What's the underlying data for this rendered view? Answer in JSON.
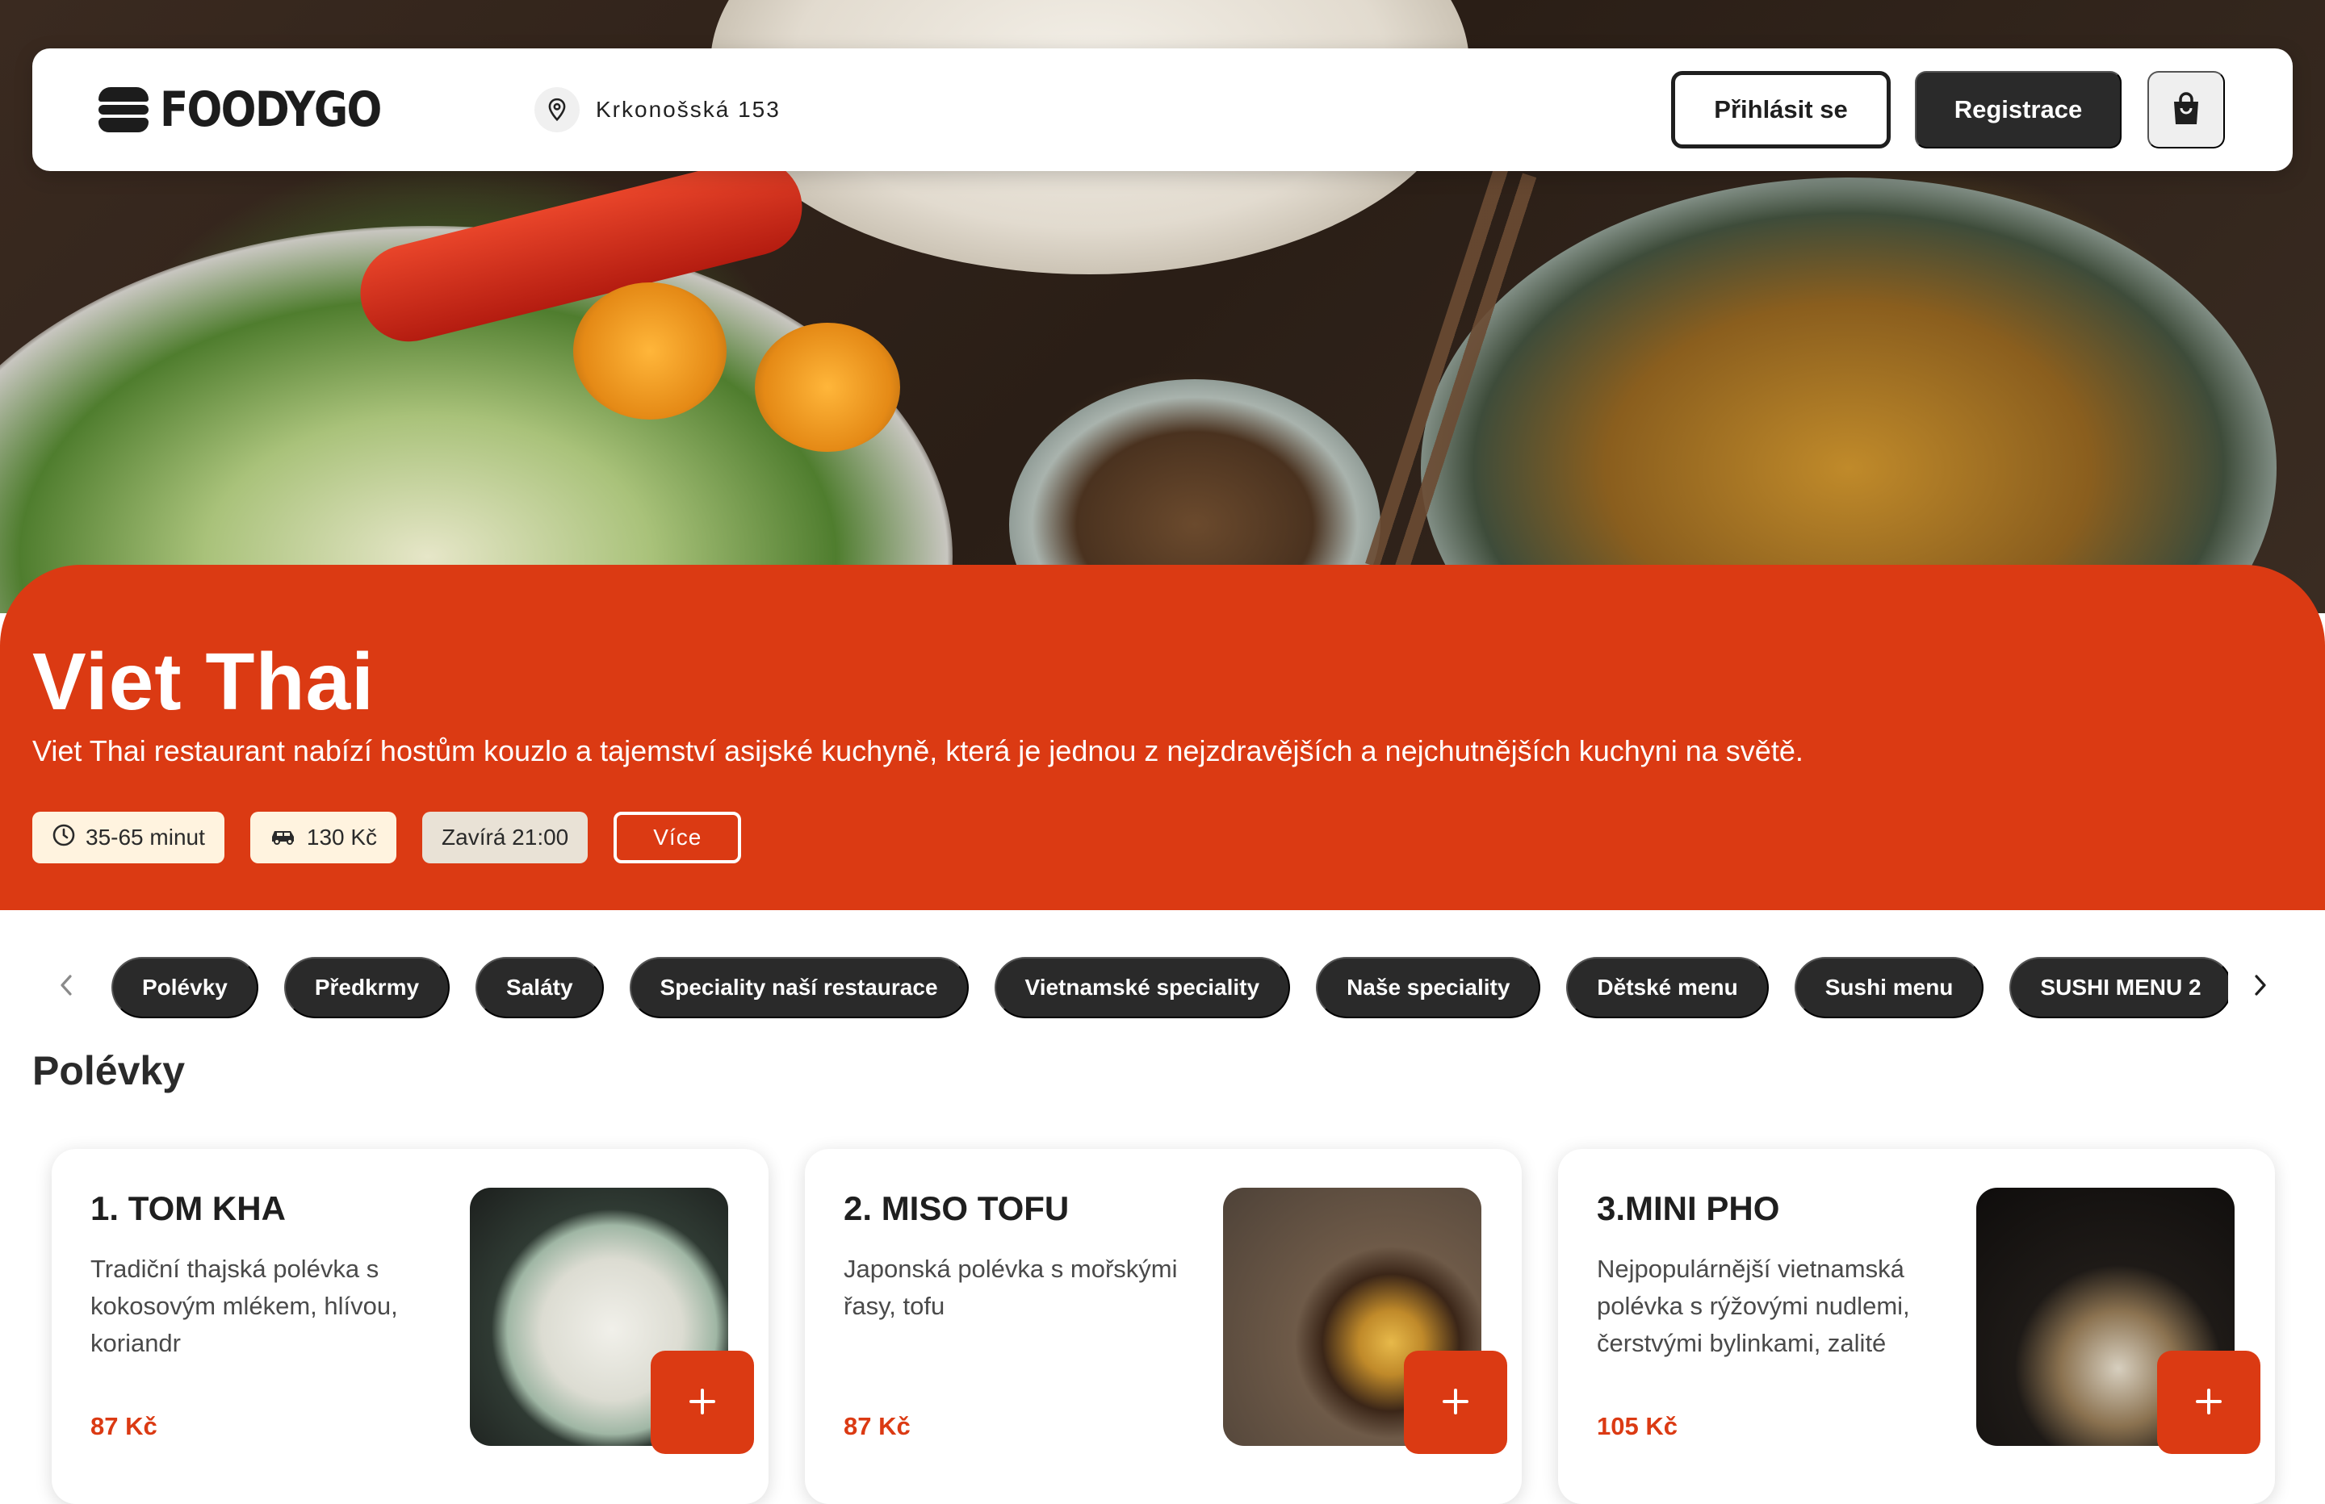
{
  "header": {
    "logo_text": "FOODYGO",
    "address": "Krkonošská 153",
    "login_label": "Přihlásit se",
    "register_label": "Registrace"
  },
  "restaurant": {
    "name": "Viet Thai",
    "description": "Viet Thai restaurant nabízí hostům kouzlo a tajemství asijské kuchyně, která je jednou z nejzdravějších a nejchutnějších kuchyni na světě.",
    "delivery_time": "35-65 minut",
    "delivery_fee": "130 Kč",
    "closing": "Zavírá 21:00",
    "more_label": "Více"
  },
  "categories": [
    "Polévky",
    "Předkrmy",
    "Saláty",
    "Speciality naší restaurace",
    "Vietnamské speciality",
    "Naše speciality",
    "Dětské menu",
    "Sushi menu",
    "SUSHI MENU 2"
  ],
  "section": {
    "title": "Polévky"
  },
  "products": [
    {
      "name": "1. TOM KHA",
      "description": "Tradiční thajská polévka s kokosovým mlékem, hlívou, koriandr",
      "price": "87 Kč"
    },
    {
      "name": "2. MISO TOFU",
      "description": "Japonská polévka s mořskými řasy, tofu",
      "price": "87 Kč"
    },
    {
      "name": "3.MINI PHO",
      "description": "Nejpopulárnější vietnamská polévka s rýžovými nudlemi, čerstvými bylinkami, zalité",
      "price": "105 Kč"
    }
  ],
  "colors": {
    "accent": "#db3a13",
    "dark": "#2a2a2a",
    "chip_bg": "#fff3df"
  },
  "icons": {
    "location": "location-pin-icon",
    "cart": "shopping-bag-icon",
    "clock": "clock-icon",
    "car": "car-icon",
    "prev": "chevron-left-icon",
    "next": "chevron-right-icon",
    "add": "plus-icon"
  }
}
